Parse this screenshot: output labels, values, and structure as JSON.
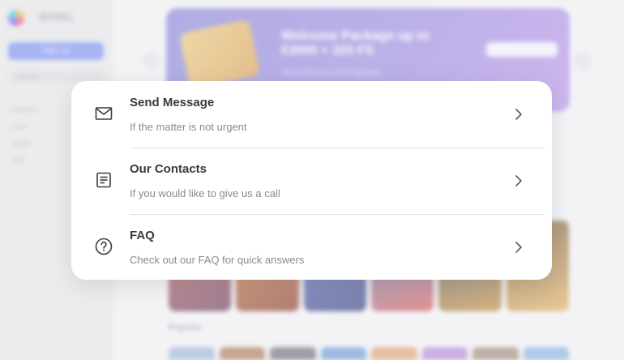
{
  "background": {
    "brand_name": "JEFBEL",
    "cta_label": "Sign Up",
    "search_placeholder": "Search",
    "nav_items": [
      "Casino",
      "Live",
      "Sport",
      "VIP"
    ],
    "banner": {
      "title": "Welcome Package up to €3000 + 325 FS",
      "subtitle": "Get a bonus on 4 first deposits",
      "button_label": "Claim"
    },
    "section_title": "Popular",
    "colors": {
      "sidebar": "#e6e6e9",
      "banner_start": "#8a86d8",
      "banner_end": "#b794e6",
      "cta": "#7d8ff0"
    }
  },
  "support_modal": {
    "items": [
      {
        "icon": "mail-icon",
        "title": "Send Message",
        "subtitle": "If the matter is not urgent"
      },
      {
        "icon": "contacts-document-icon",
        "title": "Our Contacts",
        "subtitle": "If you would like to give us a call"
      },
      {
        "icon": "help-circle-icon",
        "title": "FAQ",
        "subtitle": "Check out our FAQ for quick answers"
      }
    ],
    "colors": {
      "title": "#3a3a3c",
      "subtitle": "#8a8a8e",
      "divider": "#e3e3e6",
      "icon": "#3a3a3c"
    }
  }
}
